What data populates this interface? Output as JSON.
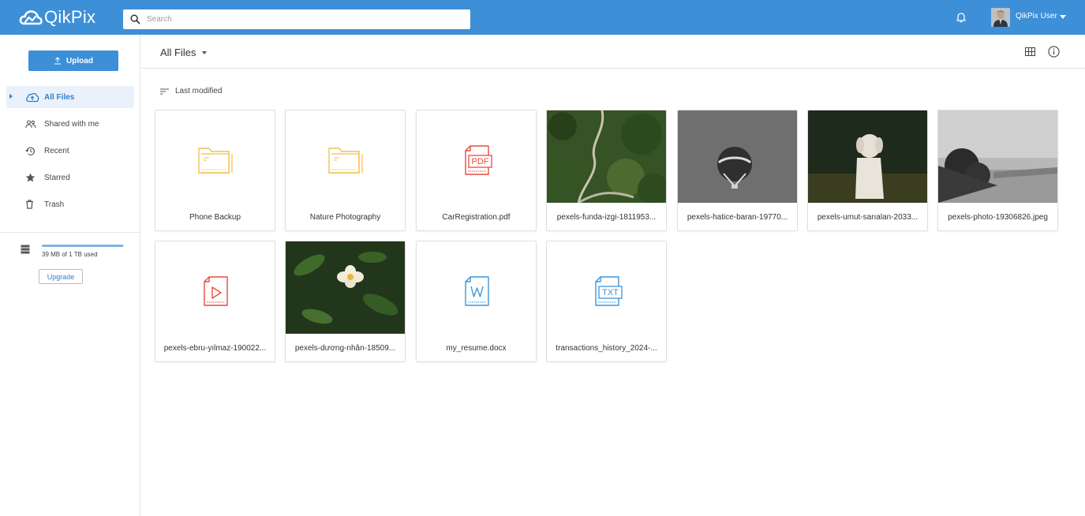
{
  "app": {
    "logo_text": "QikPix",
    "brand_color": "#3d8fd8",
    "search_placeholder": "Search",
    "user_name": "QikPix User"
  },
  "sidebar": {
    "upload_label": "Upload",
    "nav": [
      {
        "label": "All Files",
        "icon": "cloud-upload-icon",
        "active": true
      },
      {
        "label": "Shared with me",
        "icon": "people-icon",
        "active": false
      },
      {
        "label": "Recent",
        "icon": "history-icon",
        "active": false
      },
      {
        "label": "Starred",
        "icon": "star-icon",
        "active": false
      },
      {
        "label": "Trash",
        "icon": "trash-icon",
        "active": false
      }
    ],
    "storage": {
      "text": "39 MB of 1 TB used",
      "used_fraction": 0.99
    },
    "upgrade_label": "Upgrade"
  },
  "main": {
    "folder_title": "All Files",
    "sort_label": "Last modified",
    "files": [
      {
        "name": "Phone Backup",
        "kind": "folder"
      },
      {
        "name": "Nature Photography",
        "kind": "folder"
      },
      {
        "name": "CarRegistration.pdf",
        "kind": "pdf"
      },
      {
        "name": "pexels-funda-izgi-1811953...",
        "kind": "image",
        "thumb": "aerial-forest-road"
      },
      {
        "name": "pexels-hatice-baran-19770...",
        "kind": "image",
        "thumb": "hot-air-balloon-grey-sky"
      },
      {
        "name": "pexels-umut-sarıalan-2033...",
        "kind": "image",
        "thumb": "white-dog-sitting"
      },
      {
        "name": "pexels-photo-19306826.jpeg",
        "kind": "image",
        "thumb": "bw-coastline"
      },
      {
        "name": "pexels-ebru-yılmaz-190022...",
        "kind": "video"
      },
      {
        "name": "pexels-dương-nhân-18509...",
        "kind": "image",
        "thumb": "white-flower"
      },
      {
        "name": "my_resume.docx",
        "kind": "word"
      },
      {
        "name": "transactions_history_2024-...",
        "kind": "txt"
      }
    ],
    "colors": {
      "folder": "#f2c14e",
      "pdf": "#e74c3c",
      "doc": "#3d95d8"
    }
  }
}
